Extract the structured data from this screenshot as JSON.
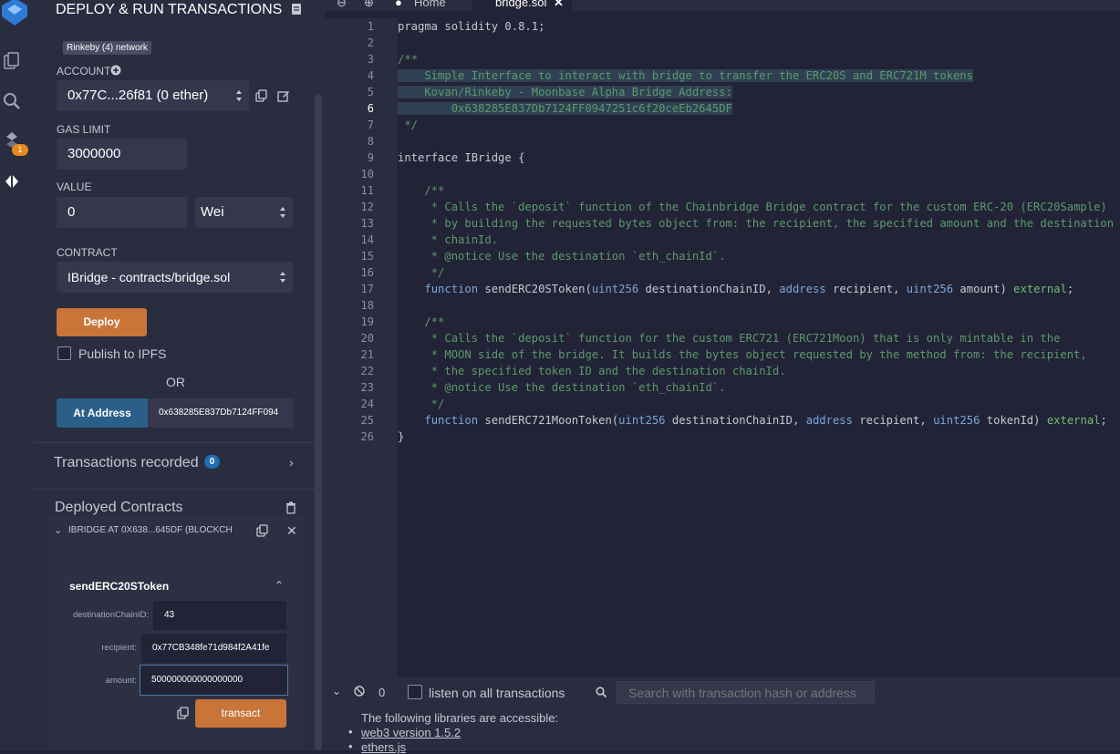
{
  "panel": {
    "title": "DEPLOY & RUN TRANSACTIONS",
    "network_badge": "Rinkeby (4) network",
    "account_label": "ACCOUNT",
    "account_value": "0x77C...26f81 (0 ether)",
    "gas_limit_label": "GAS LIMIT",
    "gas_limit_value": "3000000",
    "value_label": "VALUE",
    "value_amount": "0",
    "value_unit": "Wei",
    "contract_label": "CONTRACT",
    "contract_value": "IBridge - contracts/bridge.sol",
    "deploy_button": "Deploy",
    "publish_ipfs": "Publish to IPFS",
    "or_text": "OR",
    "at_address_button": "At Address",
    "at_address_value": "0x638285E837Db7124FF094",
    "transactions_recorded": "Transactions recorded",
    "transactions_count": "0",
    "deployed_contracts": "Deployed Contracts",
    "instance_title": "IBRIDGE AT 0X638...645DF (BLOCKCH",
    "function_name": "sendERC20SToken",
    "params": [
      {
        "label": "destinationChainID:",
        "value": "43"
      },
      {
        "label": "recipient:",
        "value": "0x77CB348fe71d984f2A41fe"
      },
      {
        "label": "amount:",
        "value": "500000000000000000"
      }
    ],
    "transact_button": "transact",
    "plugin_badge_count": "1"
  },
  "tabs": {
    "home": "Home",
    "file": "bridge.sol"
  },
  "editor": {
    "line_numbers": [
      "1",
      "2",
      "3",
      "4",
      "5",
      "6",
      "7",
      "8",
      "9",
      "10",
      "11",
      "12",
      "13",
      "14",
      "15",
      "16",
      "17",
      "18",
      "19",
      "20",
      "21",
      "22",
      "23",
      "24",
      "25",
      "26"
    ],
    "lines": [
      "pragma solidity 0.8.1;",
      "",
      "/**",
      "    Simple Interface to interact with bridge to transfer the ERC20S and ERC721M tokens",
      "    Kovan/Rinkeby - Moonbase Alpha Bridge Address:",
      "        0x638285E837Db7124FF0947251c6f20ceEb2645DF",
      " */",
      "",
      "interface IBridge {",
      "",
      "    /**",
      "     * Calls the `deposit` function of the Chainbridge Bridge contract for the custom ERC-20 (ERC20Sample)",
      "     * by building the requested bytes object from: the recipient, the specified amount and the destination",
      "     * chainId.",
      "     * @notice Use the destination `eth_chainId`.",
      "     */",
      "    function sendERC20SToken(uint256 destinationChainID, address recipient, uint256 amount) external;",
      "",
      "    /**",
      "     * Calls the `deposit` function for the custom ERC721 (ERC721Moon) that is only mintable in the",
      "     * MOON side of the bridge. It builds the bytes object requested by the method from: the recipient,",
      "     * the specified token ID and the destination chainId.",
      "     * @notice Use the destination `eth_chainId`.",
      "     */",
      "    function sendERC721MoonToken(uint256 destinationChainID, address recipient, uint256 tokenId) external;",
      "}"
    ]
  },
  "terminal": {
    "count": "0",
    "listen_label": "listen on all transactions",
    "search_placeholder": "Search with transaction hash or address",
    "libs_text": "The following libraries are accessible:",
    "lib1": "web3 version 1.5.2",
    "lib2": "ethers.js"
  },
  "colors": {
    "accent_orange": "#c97539",
    "at_address_blue": "#2b5f8a",
    "badge_blue": "#1f6fae",
    "badge_orange": "#e58a1f"
  }
}
